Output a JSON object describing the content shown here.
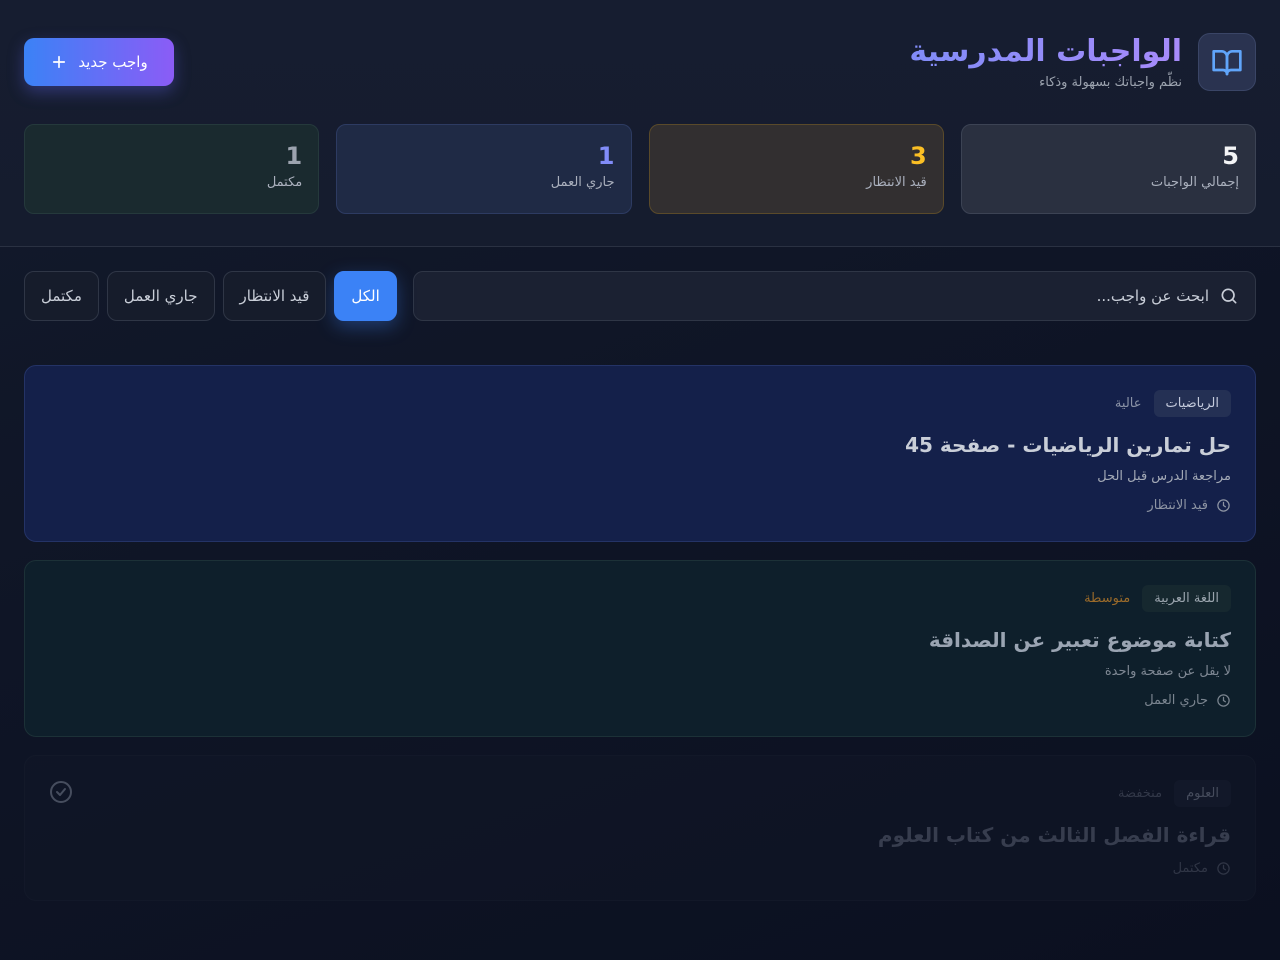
{
  "header": {
    "title": "الواجبات المدرسية",
    "subtitle": "نظّم واجباتك بسهولة وذكاء",
    "logo_icon": "open-book-icon",
    "new_button_label": "واجب جديد",
    "new_button_icon": "plus-icon"
  },
  "stats": [
    {
      "value": "5",
      "label": "إجمالي الواجبات",
      "color": "#f3f4f6"
    },
    {
      "value": "3",
      "label": "قيد الانتظار",
      "color": "#fbbf24"
    },
    {
      "value": "1",
      "label": "جاري العمل",
      "color": "#818cf8"
    },
    {
      "value": "1",
      "label": "مكتمل",
      "color": "#9ca3af"
    }
  ],
  "search": {
    "placeholder": "ابحث عن واجب...",
    "icon": "search-icon"
  },
  "filters": [
    {
      "label": "الكل",
      "active": true
    },
    {
      "label": "قيد الانتظار",
      "active": false
    },
    {
      "label": "جاري العمل",
      "active": false
    },
    {
      "label": "مكتمل",
      "active": false
    }
  ],
  "tasks": [
    {
      "subject": "الرياضيات",
      "priority": "عالية",
      "title": "حل تمارين الرياضيات - صفحة 45",
      "description": "مراجعة الدرس قبل الحل",
      "status": "قيد الانتظار"
    },
    {
      "subject": "اللغة العربية",
      "priority": "متوسطة",
      "title": "كتابة موضوع تعبير عن الصداقة",
      "description": "لا يقل عن صفحة واحدة",
      "status": "جاري العمل"
    },
    {
      "subject": "العلوم",
      "priority": "منخفضة",
      "title": "قراءة الفصل الثالث من كتاب العلوم",
      "description": "",
      "status": "مكتمل"
    }
  ],
  "accent": "#3b82f6"
}
